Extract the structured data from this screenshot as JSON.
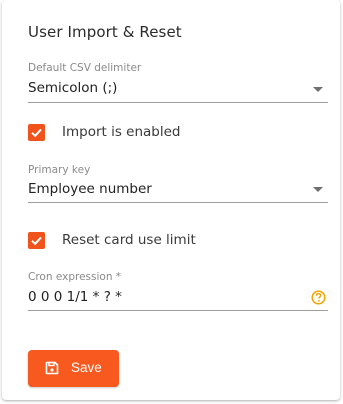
{
  "card": {
    "title": "User Import & Reset"
  },
  "delimiter": {
    "label": "Default CSV delimiter",
    "value": "Semicolon (;)"
  },
  "import_enabled": {
    "label": "Import is enabled",
    "checked": true
  },
  "primary_key": {
    "label": "Primary key",
    "value": "Employee number"
  },
  "reset_limit": {
    "label": "Reset card use limit",
    "checked": true
  },
  "cron": {
    "label": "Cron expression *",
    "value": "0 0 0 1/1 * ? *"
  },
  "save": {
    "label": "Save"
  },
  "icons": {
    "checkbox": "checkmark-icon",
    "dropdown": "chevron-down-icon",
    "help": "help-circle-icon",
    "save": "floppy-disk-icon"
  },
  "colors": {
    "accent": "#f7591f",
    "help": "#f2a300"
  }
}
